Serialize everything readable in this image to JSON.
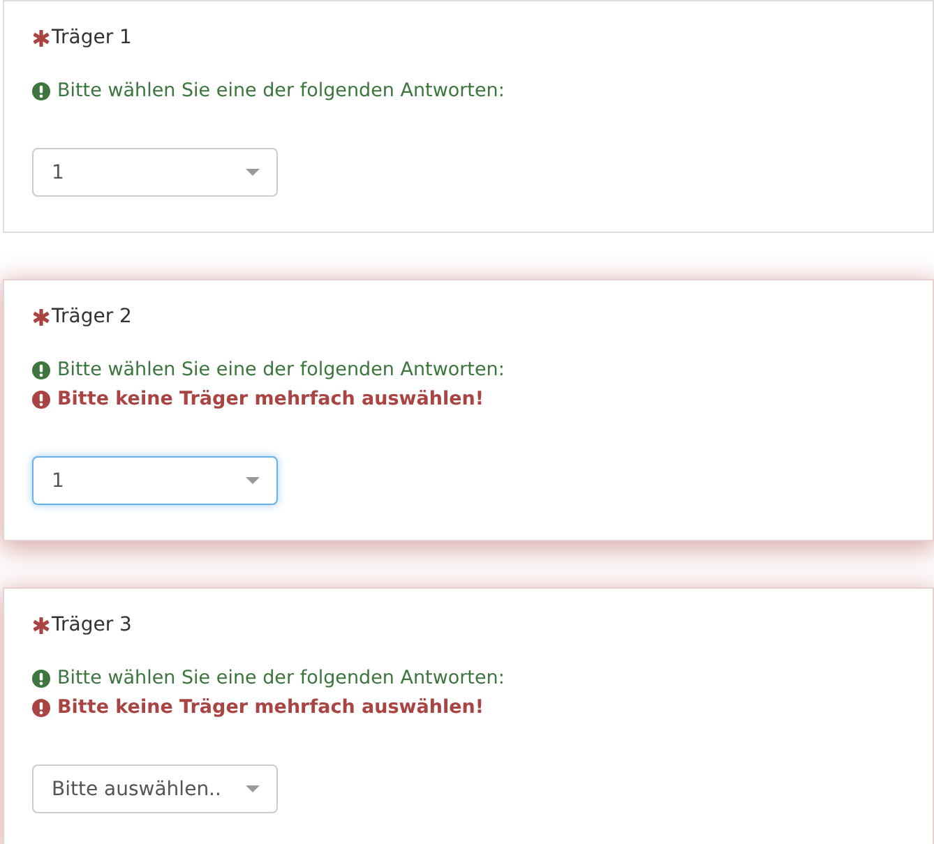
{
  "questions": [
    {
      "title": "Träger 1",
      "required": true,
      "hint": "Bitte wählen Sie eine der folgenden Antworten:",
      "has_error": false,
      "select": {
        "value": "1",
        "focused": false
      }
    },
    {
      "title": "Träger 2",
      "required": true,
      "hint": "Bitte wählen Sie eine der folgenden Antworten:",
      "has_error": true,
      "error": "Bitte keine Träger mehrfach auswählen!",
      "select": {
        "value": "1",
        "focused": true
      }
    },
    {
      "title": "Träger 3",
      "required": true,
      "hint": "Bitte wählen Sie eine der folgenden Antworten:",
      "has_error": true,
      "error": "Bitte keine Träger mehrfach auswählen!",
      "select": {
        "placeholder": "Bitte auswählen..",
        "focused": false
      }
    }
  ]
}
